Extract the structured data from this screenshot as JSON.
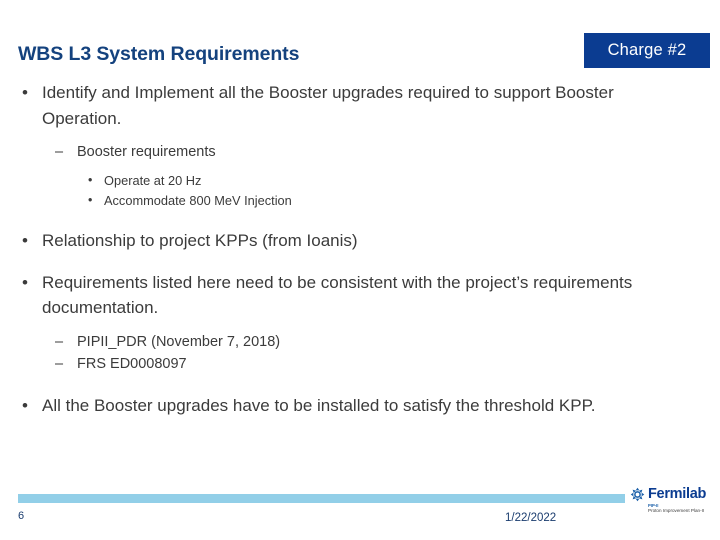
{
  "header": {
    "title": "WBS L3 System Requirements",
    "badge_label": "Charge #2",
    "badge_color": "#0b3c91",
    "title_color": "#14427e"
  },
  "content": {
    "bullets": [
      {
        "level": 1,
        "marker": "•",
        "text": "Identify and Implement all the Booster upgrades required to support Booster Operation."
      },
      {
        "level": 2,
        "marker": "–",
        "text": "Booster requirements"
      },
      {
        "level": 3,
        "marker": "•",
        "text": "Operate at 20 Hz"
      },
      {
        "level": 3,
        "marker": "•",
        "text": "Accommodate 800 MeV Injection"
      },
      {
        "level": 1,
        "marker": "•",
        "text": "Relationship to project KPPs  (from Ioanis)"
      },
      {
        "level": 1,
        "marker": "•",
        "text": "Requirements listed here need to be consistent with the project’s requirements documentation."
      },
      {
        "level": 2,
        "marker": "–",
        "text": "PIPII_PDR (November 7, 2018)"
      },
      {
        "level": 2,
        "marker": "–",
        "text": "FRS  ED0008097"
      },
      {
        "level": 1,
        "marker": "•",
        "text": "All the Booster upgrades have to be installed to satisfy the threshold KPP."
      }
    ]
  },
  "footer": {
    "page_number": "6",
    "date": "1/22/2022",
    "bar_color": "#92cfe8",
    "logo": {
      "wordmark": "Fermilab",
      "sub_line_1": "PIP-II",
      "sub_line_2": "Proton Improvement Plan-II"
    }
  }
}
